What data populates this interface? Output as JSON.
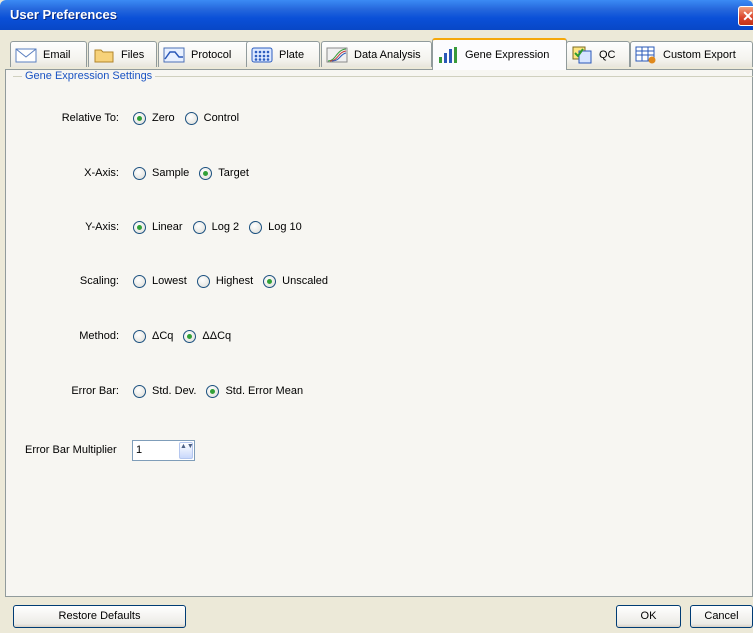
{
  "window": {
    "title": "User Preferences",
    "close_glyph": "✕"
  },
  "tabs": [
    {
      "label": "Email",
      "icon": "envelope-icon"
    },
    {
      "label": "Files",
      "icon": "folder-icon"
    },
    {
      "label": "Protocol",
      "icon": "protocol-curve-icon"
    },
    {
      "label": "Plate",
      "icon": "plate-grid-icon"
    },
    {
      "label": "Data Analysis",
      "icon": "amplification-icon"
    },
    {
      "label": "Gene Expression",
      "icon": "bar-chart-icon",
      "active": true
    },
    {
      "label": "QC",
      "icon": "qc-checklist-icon"
    },
    {
      "label": "Custom Export",
      "icon": "export-table-icon"
    }
  ],
  "group": {
    "label": "Gene Expression Settings"
  },
  "settings": {
    "relative_to": {
      "label": "Relative To:",
      "options": [
        "Zero",
        "Control"
      ],
      "selected": 0
    },
    "x_axis": {
      "label": "X-Axis:",
      "options": [
        "Sample",
        "Target"
      ],
      "selected": 1
    },
    "y_axis": {
      "label": "Y-Axis:",
      "options": [
        "Linear",
        "Log 2",
        "Log 10"
      ],
      "selected": 0
    },
    "scaling": {
      "label": "Scaling:",
      "options": [
        "Lowest",
        "Highest",
        "Unscaled"
      ],
      "selected": 2
    },
    "method": {
      "label": "Method:",
      "options": [
        "ΔCq",
        "ΔΔCq"
      ],
      "selected": 1
    },
    "error_bar": {
      "label": "Error Bar:",
      "options": [
        "Std. Dev.",
        "Std. Error Mean"
      ],
      "selected": 1
    }
  },
  "multiplier": {
    "label": "Error Bar Multiplier",
    "value": "1",
    "arrows": "▲▼"
  },
  "buttons": {
    "restore": "Restore Defaults",
    "ok": "OK",
    "cancel": "Cancel"
  },
  "colors": {
    "accent_blue": "#1a53c3",
    "radio_selected": "#31a037",
    "tab_highlight": "#f5a80a"
  }
}
